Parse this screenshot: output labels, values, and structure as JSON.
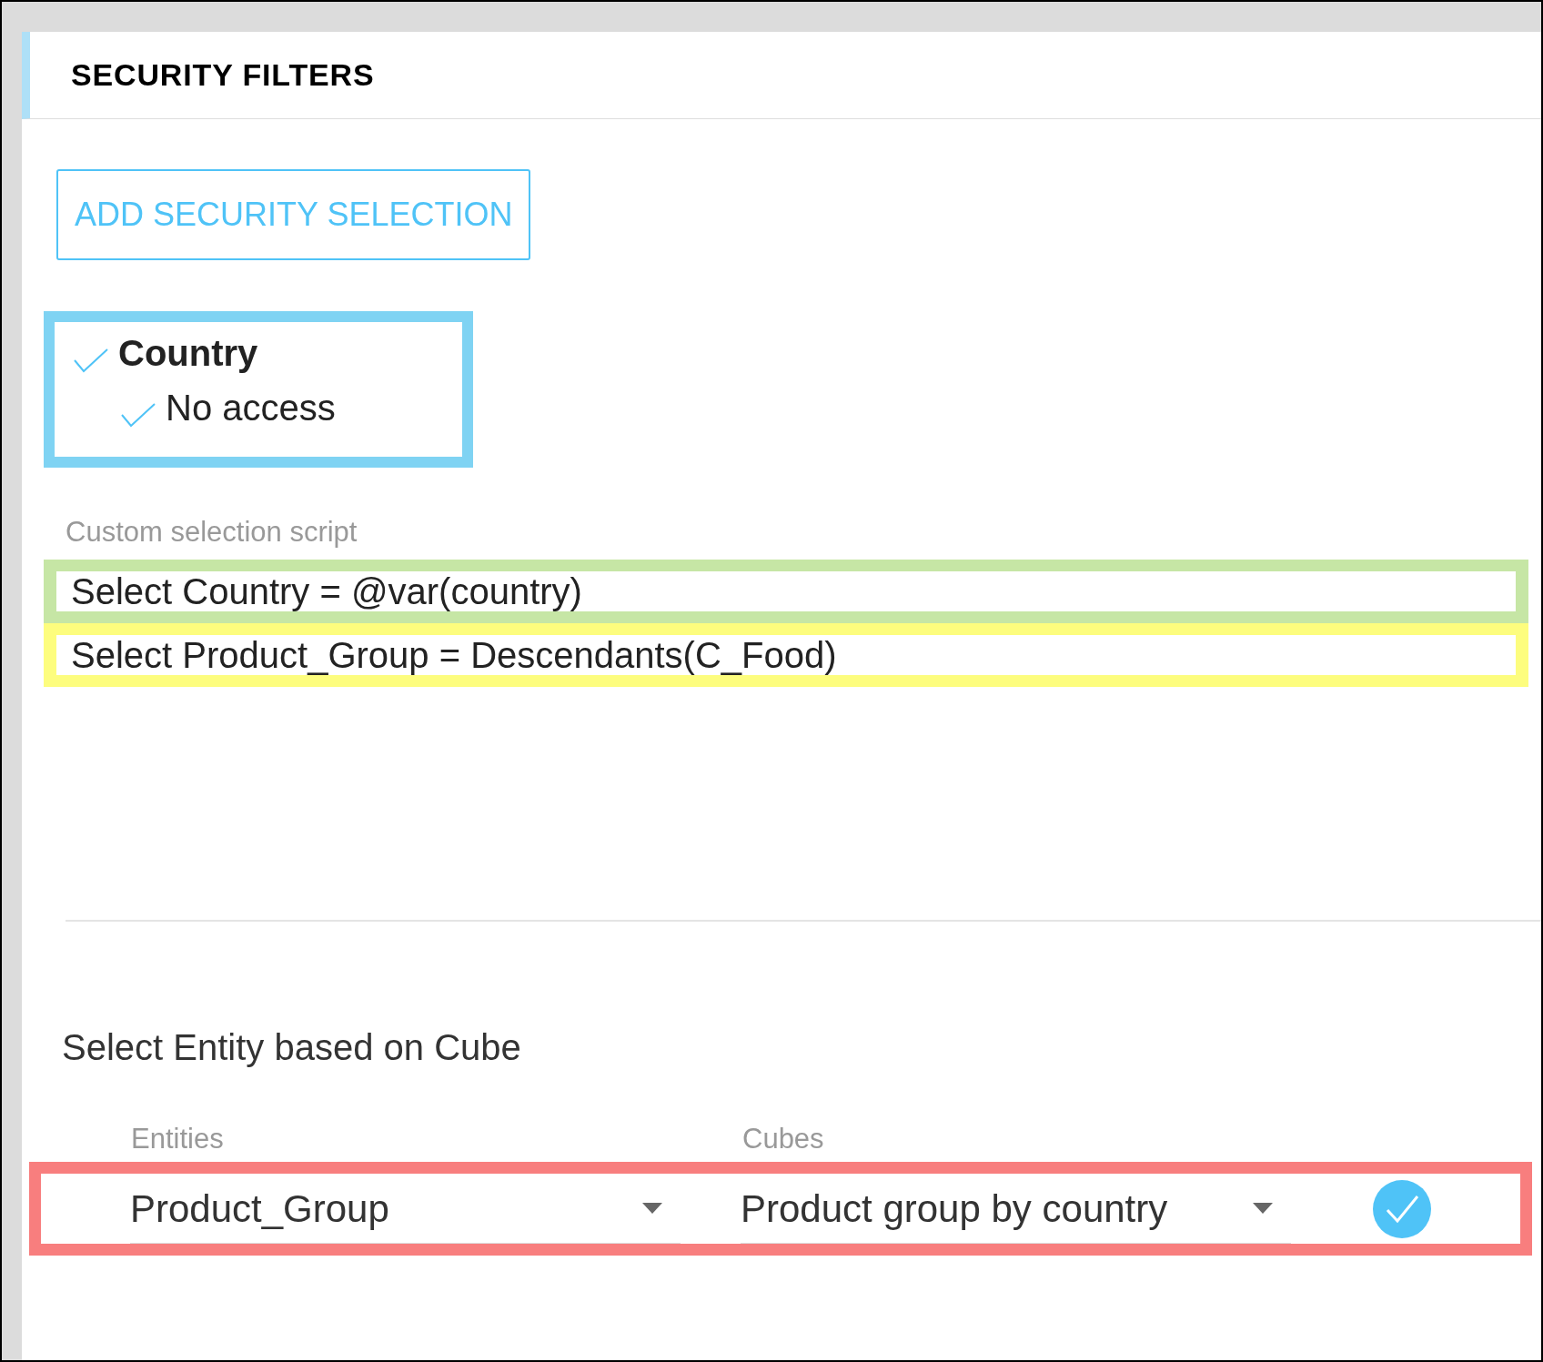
{
  "panel": {
    "title": "SECURITY FILTERS"
  },
  "add_button": {
    "label": "ADD SECURITY SELECTION"
  },
  "selection_tree": [
    {
      "label": "Country",
      "checked": true,
      "children": [
        {
          "label": "No access",
          "checked": true
        }
      ]
    }
  ],
  "script": {
    "label": "Custom selection script",
    "lines": [
      {
        "text": "Select Country = @var(country)",
        "color": "#c6e6a5"
      },
      {
        "text": "Select Product_Group = Descendants(C_Food)",
        "color": "#fdfd7e"
      }
    ]
  },
  "entity_section": {
    "title": "Select Entity based on Cube",
    "entities": {
      "label": "Entities",
      "value": "Product_Group"
    },
    "cubes": {
      "label": "Cubes",
      "value": "Product group by country"
    },
    "confirm": {
      "checked": true
    }
  }
}
